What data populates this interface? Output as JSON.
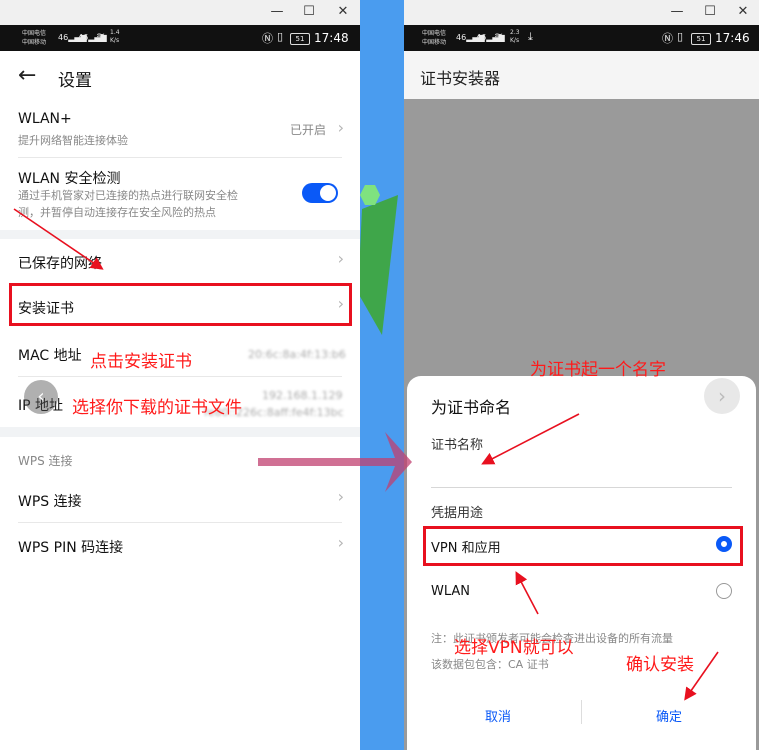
{
  "window_controls": {
    "minimize": "—",
    "maximize": "☐",
    "close": "✕"
  },
  "left_phone": {
    "status": {
      "carrier1": "中国电信",
      "carrier2": "中国移动",
      "net1": "46",
      "net2": "46",
      "speed": "1.4",
      "speed_unit": "K/s",
      "battery": "51",
      "time": "17:48"
    },
    "title": "设置",
    "wlan_plus": {
      "title": "WLAN+",
      "subtitle": "提升网络智能连接体验",
      "value": "已开启"
    },
    "wlan_security": {
      "title": "WLAN 安全检测",
      "subtitle1": "通过手机管家对已连接的热点进行联网安全检",
      "subtitle2": "测，并暂停自动连接存在安全风险的热点"
    },
    "saved_networks": "已保存的网络",
    "install_cert": "安装证书",
    "mac_address": "MAC 地址",
    "ip_address": "IP 地址",
    "mac_value": "20:6c:8a:4f:13:b6",
    "ip_value": "192.168.1.129",
    "ip_value2": "fe80::226c:8aff:fe4f:13bc",
    "wps_section": "WPS 连接",
    "wps": "WPS 连接",
    "wps_pin": "WPS PIN 码连接"
  },
  "right_phone": {
    "status": {
      "carrier1": "中国电信",
      "carrier2": "中国移动",
      "net1": "46",
      "net2": "46",
      "speed": "2.3",
      "speed_unit": "K/s",
      "battery": "51",
      "time": "17:46"
    },
    "title": "证书安装器",
    "dialog": {
      "title": "为证书命名",
      "name_label": "证书名称",
      "usage_label": "凭据用途",
      "option_vpn": "VPN 和应用",
      "option_wlan": "WLAN",
      "note1": "注：此证书颁发者可能会检查进出设备的所有流量",
      "note2": "该数据包包含：CA 证书",
      "cancel": "取消",
      "confirm": "确定",
      "selected": "VPN 和应用"
    }
  },
  "annotations": {
    "click_install": "点击安装证书",
    "choose_file": "选择你下载的证书文件",
    "name_cert": "为证书起一个名字",
    "choose_vpn": "选择VPN就可以",
    "confirm_install": "确认安装"
  },
  "colors": {
    "accent": "#0a59f7",
    "annotation_red": "#ff1a1a",
    "statusbar": "#111111"
  }
}
